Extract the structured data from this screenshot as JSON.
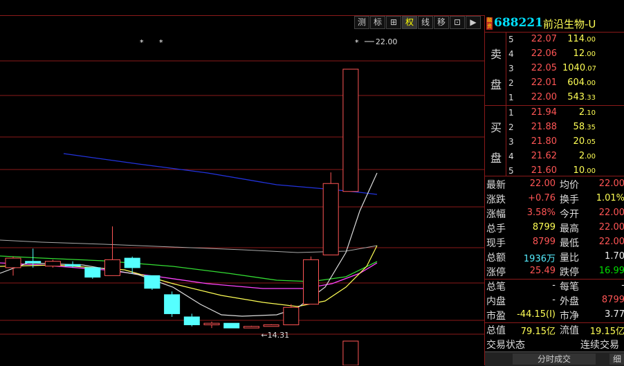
{
  "toolbar": [
    {
      "label": "测",
      "active": false
    },
    {
      "label": "标",
      "active": false
    },
    {
      "label": "⊞",
      "active": false
    },
    {
      "label": "权",
      "active": true
    },
    {
      "label": "线",
      "active": false
    },
    {
      "label": "移",
      "active": false
    },
    {
      "label": "⊡",
      "active": false
    },
    {
      "label": "▶",
      "active": false
    }
  ],
  "stock": {
    "flag": "融资",
    "code": "688221",
    "name": "前沿生物-U"
  },
  "sell_label": "卖盘",
  "buy_label": "买盘",
  "sell_orders": [
    {
      "level": "5",
      "price": "22.07",
      "vol_main": "114",
      "vol_dec": ".00"
    },
    {
      "level": "4",
      "price": "22.06",
      "vol_main": "12",
      "vol_dec": ".00"
    },
    {
      "level": "3",
      "price": "22.05",
      "vol_main": "1040",
      "vol_dec": ".07"
    },
    {
      "level": "2",
      "price": "22.01",
      "vol_main": "604",
      "vol_dec": ".00"
    },
    {
      "level": "1",
      "price": "22.00",
      "vol_main": "543",
      "vol_dec": ".33"
    }
  ],
  "buy_orders": [
    {
      "level": "1",
      "price": "21.94",
      "vol_main": "2",
      "vol_dec": ".10"
    },
    {
      "level": "2",
      "price": "21.88",
      "vol_main": "58",
      "vol_dec": ".35"
    },
    {
      "level": "3",
      "price": "21.80",
      "vol_main": "20",
      "vol_dec": ".05"
    },
    {
      "level": "4",
      "price": "21.62",
      "vol_main": "2",
      "vol_dec": ".00"
    },
    {
      "level": "5",
      "price": "21.60",
      "vol_main": "10",
      "vol_dec": ".00"
    }
  ],
  "stats": [
    {
      "l1": "最新",
      "v1": "22.00",
      "c1": "red",
      "l2": "均价",
      "v2": "22.00",
      "c2": "red"
    },
    {
      "l1": "涨跌",
      "v1": "+0.76",
      "c1": "red",
      "l2": "换手",
      "v2": "1.01%",
      "c2": "yel"
    },
    {
      "l1": "涨幅",
      "v1": "3.58%",
      "c1": "red",
      "l2": "今开",
      "v2": "22.00",
      "c2": "red"
    },
    {
      "l1": "总手",
      "v1": "8799",
      "c1": "yel",
      "l2": "最高",
      "v2": "22.00",
      "c2": "red"
    },
    {
      "l1": "现手",
      "v1": "8799",
      "c1": "red",
      "l2": "最低",
      "v2": "22.00",
      "c2": "red"
    },
    {
      "l1": "总额",
      "v1": "1936万",
      "c1": "cyan",
      "l2": "量比",
      "v2": "1.70",
      "c2": "wht"
    },
    {
      "l1": "涨停",
      "v1": "25.49",
      "c1": "red",
      "l2": "跌停",
      "v2": "16.99",
      "c2": "grn"
    },
    {
      "l1": "总笔",
      "v1": "-",
      "c1": "wht",
      "l2": "每笔",
      "v2": "-",
      "c2": "wht"
    },
    {
      "l1": "内盘",
      "v1": "-",
      "c1": "wht",
      "l2": "外盘",
      "v2": "8799",
      "c2": "red"
    },
    {
      "l1": "市盈",
      "v1": "-44.15(Ⅰ)",
      "c1": "yel",
      "l2": "市净",
      "v2": "3.77",
      "c2": "wht"
    },
    {
      "l1": "总值",
      "v1": "79.15亿",
      "c1": "yel",
      "l2": "流值",
      "v2": "19.15亿",
      "c2": "yel"
    },
    {
      "l1": "交易状态",
      "v1": "",
      "c1": "wht",
      "l2": "连续交易",
      "v2": "",
      "c2": "wht"
    }
  ],
  "bottom": {
    "tab1": "分时成交",
    "tab2": "细"
  },
  "chart_labels": {
    "high": "22.00",
    "low": "14.31"
  },
  "colors": {
    "up": "#ff5555",
    "down": "#55ffff",
    "grid": "#8b1a1a",
    "ma_blue": "#2233dd",
    "ma_white": "#dddddd",
    "ma_yellow": "#ffff55",
    "ma_magenta": "#ff44ff",
    "ma_green": "#33dd33"
  },
  "chart_data": {
    "type": "candlestick",
    "candles": [
      {
        "o": 15.75,
        "c": 16.05,
        "h": 16.1,
        "l": 15.5
      },
      {
        "o": 15.95,
        "c": 15.9,
        "h": 16.35,
        "l": 15.75
      },
      {
        "o": 15.8,
        "c": 15.95,
        "h": 16.0,
        "l": 15.75
      },
      {
        "o": 15.85,
        "c": 15.8,
        "h": 15.95,
        "l": 15.75
      },
      {
        "o": 15.75,
        "c": 15.45,
        "h": 15.75,
        "l": 15.4
      },
      {
        "o": 15.5,
        "c": 16.0,
        "h": 17.05,
        "l": 15.5
      },
      {
        "o": 16.05,
        "c": 15.75,
        "h": 16.1,
        "l": 15.55
      },
      {
        "o": 15.5,
        "c": 15.1,
        "h": 15.5,
        "l": 15.05
      },
      {
        "o": 14.9,
        "c": 14.3,
        "h": 15.0,
        "l": 14.2
      },
      {
        "o": 14.2,
        "c": 13.95,
        "h": 14.3,
        "l": 13.9
      },
      {
        "o": 13.95,
        "c": 14.0,
        "h": 14.05,
        "l": 13.85
      },
      {
        "o": 14.0,
        "c": 13.85,
        "h": 14.0,
        "l": 13.85
      },
      {
        "o": 13.85,
        "c": 13.9,
        "h": 13.92,
        "l": 13.85
      },
      {
        "o": 13.9,
        "c": 13.95,
        "h": 13.97,
        "l": 13.9
      },
      {
        "o": 13.95,
        "c": 14.5,
        "h": 14.6,
        "l": 13.95
      },
      {
        "o": 14.6,
        "c": 16.0,
        "h": 16.1,
        "l": 14.6
      },
      {
        "o": 16.15,
        "c": 18.4,
        "h": 18.75,
        "l": 16.15
      },
      {
        "o": 18.15,
        "c": 22.0,
        "h": 22.0,
        "l": 18.15
      }
    ],
    "annotations": {
      "high": 22.0,
      "low": 14.31
    }
  }
}
